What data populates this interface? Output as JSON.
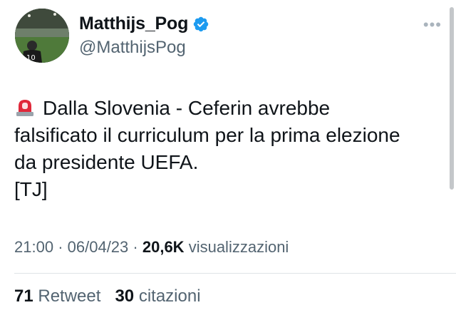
{
  "author": {
    "display_name": "Matthijs_Pog",
    "handle": "@MatthijsPog",
    "avatar_jersey_number": "10",
    "verified_color": "#1d9bf0"
  },
  "more_icon": "more-horizontal-icon",
  "tweet": {
    "emoji_icon": "rotating-light-icon",
    "lines": [
      "Dalla Slovenia - Ceferin avrebbe",
      "falsificato il curriculum per la prima elezione",
      "da presidente UEFA.",
      "[TJ]"
    ]
  },
  "meta": {
    "time": "21:00",
    "sep1": "·",
    "date": "06/04/23",
    "sep2": "·",
    "views_count": "20,6K",
    "views_label": "visualizzazioni"
  },
  "stats": {
    "retweets_count": "71",
    "retweets_label": "Retweet",
    "quotes_count": "30",
    "quotes_label": "citazioni"
  }
}
